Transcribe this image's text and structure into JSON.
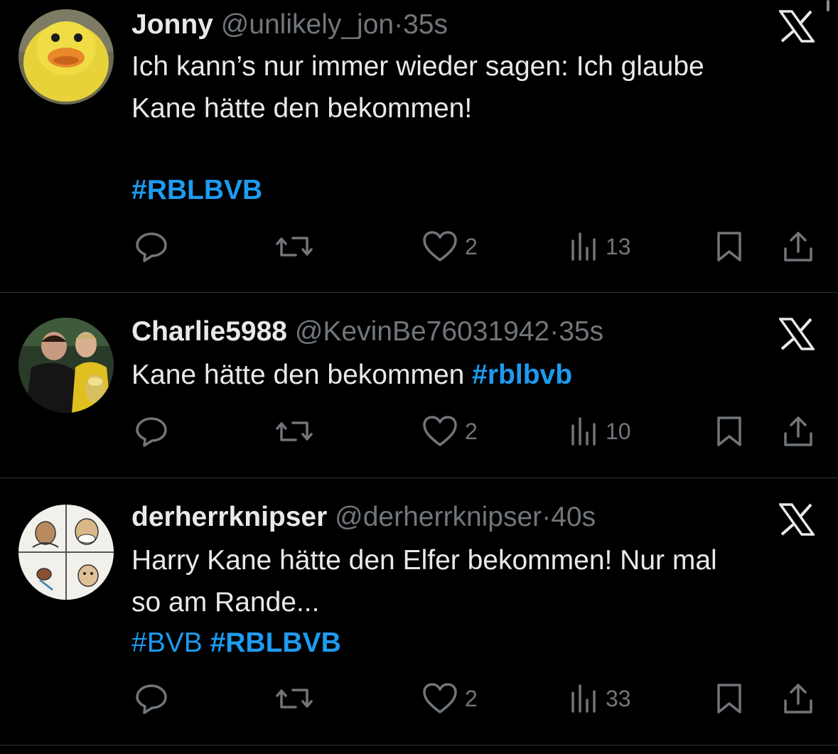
{
  "tweets": [
    {
      "name": "Jonny",
      "handle": "@unlikely_jon",
      "separator": "·",
      "time": "35s",
      "text_lines": [
        "Ich kann’s nur immer wieder sagen: Ich glaube",
        "Kane hätte den bekommen!"
      ],
      "hashtag_line": "#RBLBVB",
      "likes": "2",
      "views": "13"
    },
    {
      "name": "Charlie5988",
      "handle": "@KevinBe76031942",
      "separator": "·",
      "time": "35s",
      "text": "Kane hätte den bekommen ",
      "hashtag": "#rblbvb",
      "likes": "2",
      "views": "10"
    },
    {
      "name": "derherrknipser",
      "handle": "@derherrknipser",
      "separator": "·",
      "time": "40s",
      "text_lines": [
        "Harry Kane hätte den Elfer bekommen! Nur mal",
        "so am Rande..."
      ],
      "hashtag_1": "#BVB",
      "hashtag_2": "#RBLBVB",
      "likes": "2",
      "views": "33"
    }
  ],
  "icons": {
    "platform": "x-logo-icon",
    "reply": "reply-icon",
    "repost": "repost-icon",
    "like": "heart-icon",
    "views": "views-icon",
    "bookmark": "bookmark-icon",
    "share": "share-icon"
  },
  "colors": {
    "background": "#000000",
    "text": "#e7e9ea",
    "muted": "#71767b",
    "hashtag": "#1d9bf0",
    "divider": "#2f3336"
  }
}
